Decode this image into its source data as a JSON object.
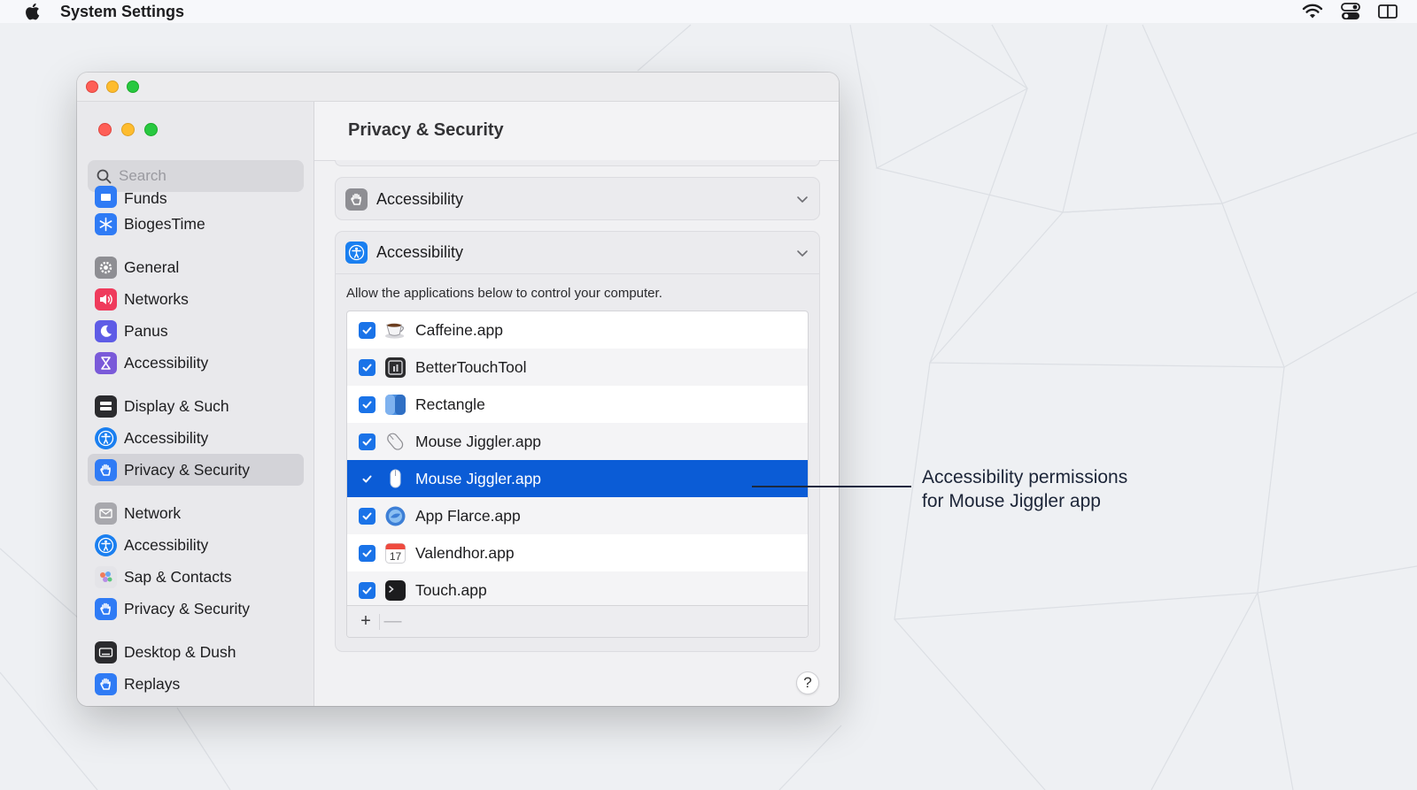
{
  "menubar": {
    "app_name": "System Settings",
    "icons": [
      "apple-logo",
      "wifi-icon",
      "control-center-icon",
      "split-view-icon"
    ]
  },
  "sidebar": {
    "search_placeholder": "Search",
    "items": [
      {
        "label": "Funds",
        "icon": "funds-icon",
        "color": "#2f7bf5"
      },
      {
        "label": "BiogesTime",
        "icon": "snowflake-icon",
        "color": "#2f7bf5"
      },
      {
        "label": "General",
        "icon": "gear-icon",
        "color": "#8e8e93"
      },
      {
        "label": "Networks",
        "icon": "speaker-icon",
        "color": "#ef3b5c"
      },
      {
        "label": "Panus",
        "icon": "moon-icon",
        "color": "#5e5ce6"
      },
      {
        "label": "Accessibility",
        "icon": "hourglass-icon",
        "color": "#7a5ad9"
      },
      {
        "label": "Display & Such",
        "icon": "display-icon",
        "color": "#2b2b2e"
      },
      {
        "label": "Accessibility",
        "icon": "accessibility-icon",
        "color": "#1a7ff0"
      },
      {
        "label": "Privacy & Security",
        "icon": "hand-icon",
        "color": "#2f7bf5",
        "selected": true
      },
      {
        "label": "Network",
        "icon": "envelope-icon",
        "color": "#a8a8ad"
      },
      {
        "label": "Accessibility",
        "icon": "accessibility-icon",
        "color": "#1a7ff0"
      },
      {
        "label": "Sap & Contacts",
        "icon": "contacts-icon",
        "color": "#c9c9ce"
      },
      {
        "label": "Privacy & Security",
        "icon": "hand-icon",
        "color": "#2f7bf5"
      },
      {
        "label": "Desktop & Dush",
        "icon": "keyboard-icon",
        "color": "#2b2b2e"
      },
      {
        "label": "Replays",
        "icon": "hand-icon",
        "color": "#2f7bf5"
      }
    ]
  },
  "main": {
    "title": "Privacy & Security",
    "sections": [
      {
        "label": "Accessibility",
        "icon": "hand-icon"
      },
      {
        "label": "Accessibility",
        "icon": "accessibility-icon"
      }
    ],
    "description": "Allow the applications below to control your computer.",
    "apps": [
      {
        "name": "Caffeine.app",
        "icon": "coffee-cup-icon",
        "checked": true
      },
      {
        "name": "BetterTouchTool",
        "icon": "bettertouchtool-icon",
        "checked": true
      },
      {
        "name": "Rectangle",
        "icon": "rectangle-icon",
        "checked": true
      },
      {
        "name": "Mouse Jiggler.app",
        "icon": "mouse-icon",
        "checked": true
      },
      {
        "name": "Mouse Jiggler.app",
        "icon": "mouse-icon",
        "checked": true,
        "selected": true
      },
      {
        "name": "App Flarce.app",
        "icon": "globe-icon",
        "checked": true
      },
      {
        "name": "Valendhor.app",
        "icon": "calendar-icon",
        "checked": true,
        "calendar_day": "17"
      },
      {
        "name": "Touch.app",
        "icon": "terminal-icon",
        "checked": true
      }
    ],
    "add_label": "+",
    "remove_label": "—",
    "help_label": "?"
  },
  "callout": {
    "line1": "Accessibility permissions",
    "line2": "for Mouse Jiggler app"
  },
  "colors": {
    "selection": "#0b5cd6",
    "checkbox": "#1a73e8",
    "accent": "#2f7bf5"
  }
}
